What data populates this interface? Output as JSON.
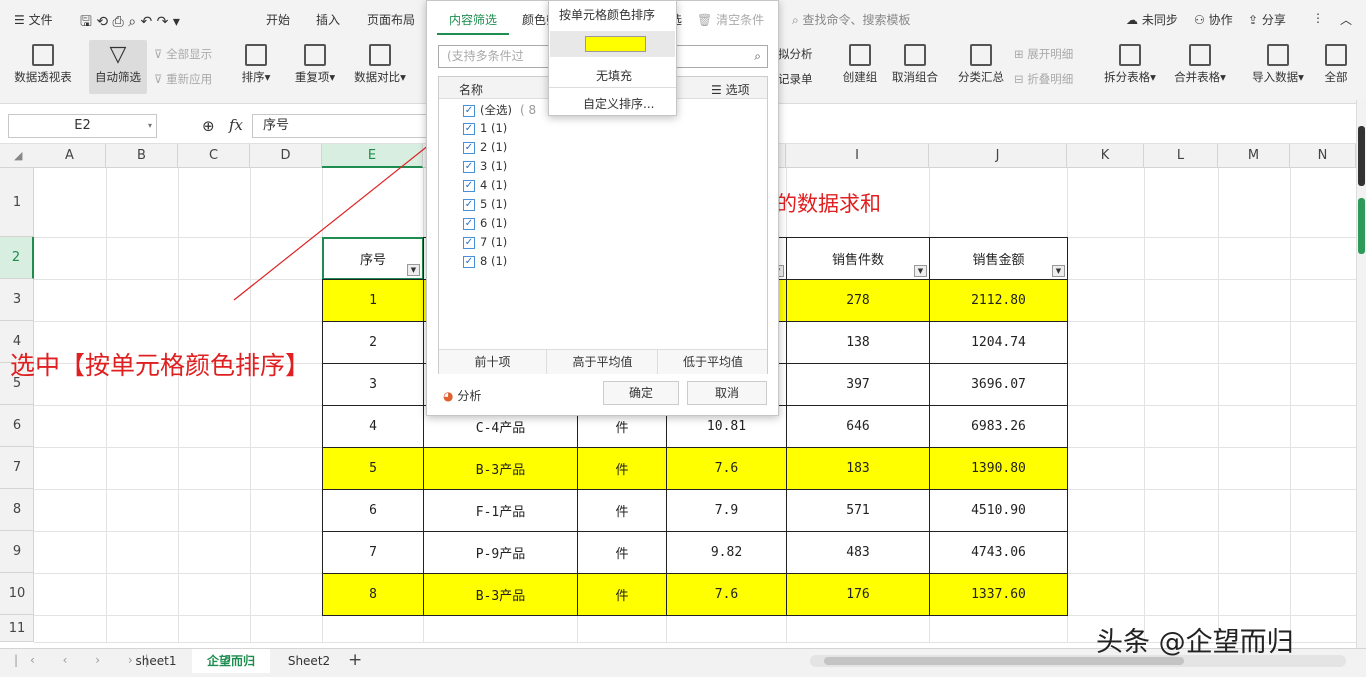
{
  "menu": {
    "file": "文件",
    "tabs": [
      "开始",
      "插入",
      "页面布局"
    ],
    "sync": "未同步",
    "collab": "协作",
    "share": "分享",
    "search_placeholder": "查找命令、搜索模板"
  },
  "ribbon": {
    "pivot": "数据透视表",
    "autofilter": "自动筛选",
    "show_all": "全部显示",
    "reapply": "重新应用",
    "sort": "排序",
    "duplicate": "重复项",
    "compare": "数据对比",
    "sim": "拟分析",
    "record": "记录单",
    "create_group": "创建组",
    "ungroup": "取消组合",
    "subtotal": "分类汇总",
    "expand": "展开明细",
    "collapse": "折叠明细",
    "split_table": "拆分表格",
    "merge_table": "合并表格",
    "import": "导入数据",
    "all": "全部",
    "clear_cond": "清空条件",
    "filter_label": "选"
  },
  "formula": {
    "cell_ref": "E2",
    "content": "序号",
    "fx": "fx"
  },
  "columns": [
    "A",
    "B",
    "C",
    "D",
    "E",
    "F",
    "G",
    "H",
    "I",
    "J",
    "K",
    "L",
    "M",
    "N"
  ],
  "rows": [
    "1",
    "2",
    "3",
    "4",
    "5",
    "6",
    "7",
    "8",
    "9",
    "10",
    "11"
  ],
  "title_text": "的数据求和",
  "table": {
    "headers": [
      "序号",
      "",
      "",
      "",
      "销售件数",
      "销售金额"
    ],
    "rows": [
      {
        "c": [
          "1",
          "",
          "",
          "",
          "278",
          "2112.80"
        ],
        "yellow": true
      },
      {
        "c": [
          "2",
          "",
          "",
          "",
          "138",
          "1204.74"
        ],
        "yellow": false
      },
      {
        "c": [
          "3",
          "",
          "",
          "",
          "397",
          "3696.07"
        ],
        "yellow": false
      },
      {
        "c": [
          "4",
          "C-4产品",
          "件",
          "10.81",
          "646",
          "6983.26"
        ],
        "yellow": false
      },
      {
        "c": [
          "5",
          "B-3产品",
          "件",
          "7.6",
          "183",
          "1390.80"
        ],
        "yellow": true
      },
      {
        "c": [
          "6",
          "F-1产品",
          "件",
          "7.9",
          "571",
          "4510.90"
        ],
        "yellow": false
      },
      {
        "c": [
          "7",
          "P-9产品",
          "件",
          "9.82",
          "483",
          "4743.06"
        ],
        "yellow": false
      },
      {
        "c": [
          "8",
          "B-3产品",
          "件",
          "7.6",
          "176",
          "1337.60"
        ],
        "yellow": true
      }
    ]
  },
  "annotation": "选中【按单元格颜色排序】",
  "dialog": {
    "tab_content": "内容筛选",
    "tab_color": "颜色筛",
    "search_placeholder": "(支持多条件过",
    "col_name": "名称",
    "options": "选项",
    "items": [
      "(全选)",
      "1 (1)",
      "2 (1)",
      "3 (1)",
      "4 (1)",
      "5 (1)",
      "6 (1)",
      "7 (1)",
      "8 (1)"
    ],
    "select_all_count": "( 8",
    "btn_top10": "前十项",
    "btn_above": "高于平均值",
    "btn_below": "低于平均值",
    "analyze": "分析",
    "ok": "确定",
    "cancel": "取消"
  },
  "context_menu": {
    "title": "按单元格颜色排序",
    "no_fill": "无填充",
    "custom": "自定义排序...",
    "swatch_color": "#ffff00"
  },
  "sheets": [
    "sheet1",
    "企望而归",
    "Sheet2"
  ],
  "watermark": "头条 @企望而归",
  "colors": {
    "accent": "#1f8d4f",
    "highlight": "#ffff00",
    "annotation": "#e02020"
  }
}
